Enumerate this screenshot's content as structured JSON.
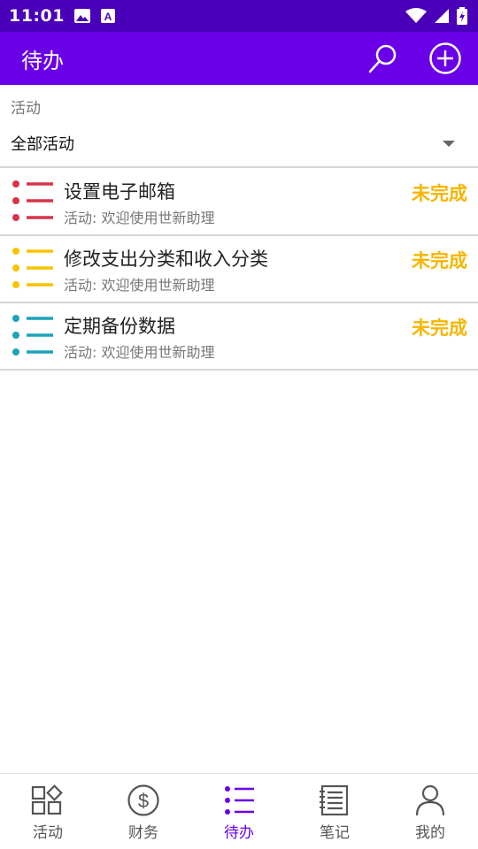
{
  "status_bar": {
    "time": "11:01"
  },
  "app_bar": {
    "title": "待办"
  },
  "filter": {
    "label": "活动",
    "selected": "全部活动"
  },
  "todos": [
    {
      "title": "设置电子邮箱",
      "subtitle": "活动: 欢迎使用世新助理",
      "status": "未完成",
      "icon_color": "#d8334a",
      "icon": "list-icon"
    },
    {
      "title": "修改支出分类和收入分类",
      "subtitle": "活动: 欢迎使用世新助理",
      "status": "未完成",
      "icon_color": "#f7c400",
      "icon": "list-icon"
    },
    {
      "title": "定期备份数据",
      "subtitle": "活动: 欢迎使用世新助理",
      "status": "未完成",
      "icon_color": "#1ca3b8",
      "icon": "list-icon"
    }
  ],
  "bottom_nav": {
    "tabs": [
      {
        "label": "活动",
        "icon": "activity-icon"
      },
      {
        "label": "财务",
        "icon": "dollar-icon"
      },
      {
        "label": "待办",
        "icon": "todo-list-icon"
      },
      {
        "label": "笔记",
        "icon": "notebook-icon"
      },
      {
        "label": "我的",
        "icon": "person-icon"
      }
    ],
    "active": "待办"
  },
  "colors": {
    "status_bar": "#4a00b8",
    "app_bar": "#6a00e8",
    "status_text": "#f7b500",
    "active_tab": "#6a00e8"
  }
}
